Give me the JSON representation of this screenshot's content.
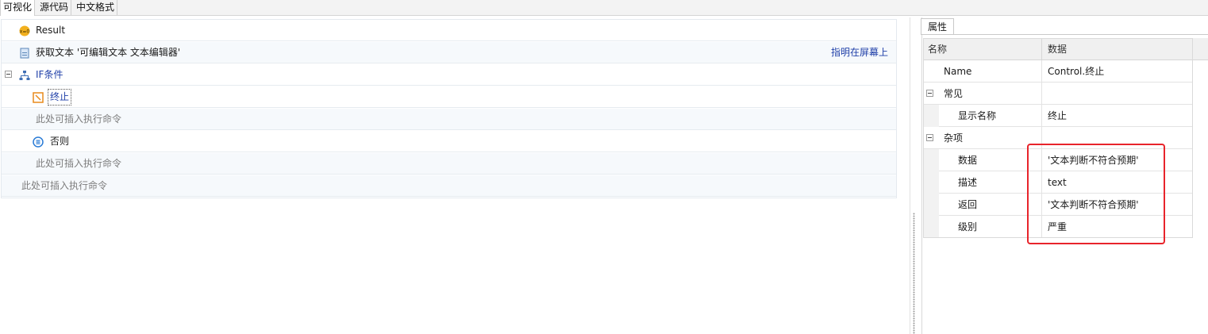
{
  "tabs": [
    "可视化",
    "源代码",
    "中文格式"
  ],
  "workflow": {
    "result_label": "Result",
    "get_text_label": "获取文本 '可编辑文本 文本编辑器'",
    "get_text_link": "指明在屏幕上",
    "if_label": "IF条件",
    "stop_label": "终止",
    "insert_hint": "此处可插入执行命令",
    "else_label": "否则"
  },
  "properties": {
    "tab_label": "属性",
    "col_name": "名称",
    "col_data": "数据",
    "rows": [
      {
        "name": "Name",
        "value": "Control.终止"
      },
      {
        "name": "常见",
        "value": ""
      },
      {
        "name": "显示名称",
        "value": "终止"
      },
      {
        "name": "杂项",
        "value": ""
      },
      {
        "name": "数据",
        "value": "'文本判断不符合预期'"
      },
      {
        "name": "描述",
        "value": "text"
      },
      {
        "name": "返回",
        "value": "'文本判断不符合预期'"
      },
      {
        "name": "级别",
        "value": "严重"
      }
    ]
  },
  "colors": {
    "highlight": "#e8242b",
    "link": "#1f3fa8"
  }
}
